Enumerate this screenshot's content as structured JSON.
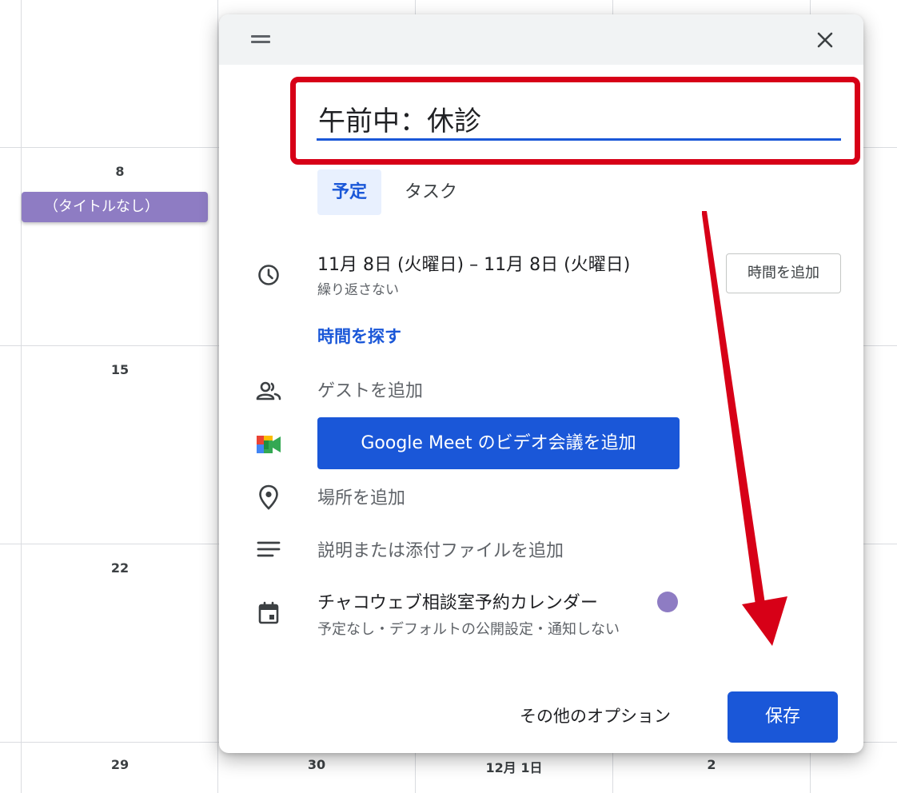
{
  "calendar": {
    "day_numbers": [
      "8",
      "15",
      "22",
      "29",
      "30",
      "12月 1日",
      "2"
    ],
    "event_chip": "（タイトルなし）"
  },
  "dialog": {
    "title_value": "午前中：休診",
    "tabs": [
      {
        "label": "予定",
        "active": true
      },
      {
        "label": "タスク",
        "active": false
      }
    ],
    "date_range": "11月 8日 (火曜日)  –  11月 8日 (火曜日)",
    "repeat": "繰り返さない",
    "add_time_button": "時間を追加",
    "find_time_link": "時間を探す",
    "add_guests": "ゲストを追加",
    "meet_button": "Google Meet のビデオ会議を追加",
    "add_location": "場所を追加",
    "add_description": "説明または添付ファイルを追加",
    "calendar_name": "チャコウェブ相談室予約カレンダー",
    "calendar_color": "#8e7cc3",
    "calendar_details": "予定なし・デフォルトの公開設定・通知しない",
    "more_options": "その他のオプション",
    "save_button": "保存"
  },
  "icons": {
    "close": "close-icon",
    "drag": "drag-handle-icon",
    "clock": "clock-icon",
    "guests": "people-icon",
    "meet": "google-meet-icon",
    "location": "location-pin-icon",
    "description": "notes-icon",
    "calendar": "calendar-icon"
  },
  "colors": {
    "accent": "#1a57d8",
    "highlight": "#d70017",
    "event_purple": "#8e7cc3"
  }
}
